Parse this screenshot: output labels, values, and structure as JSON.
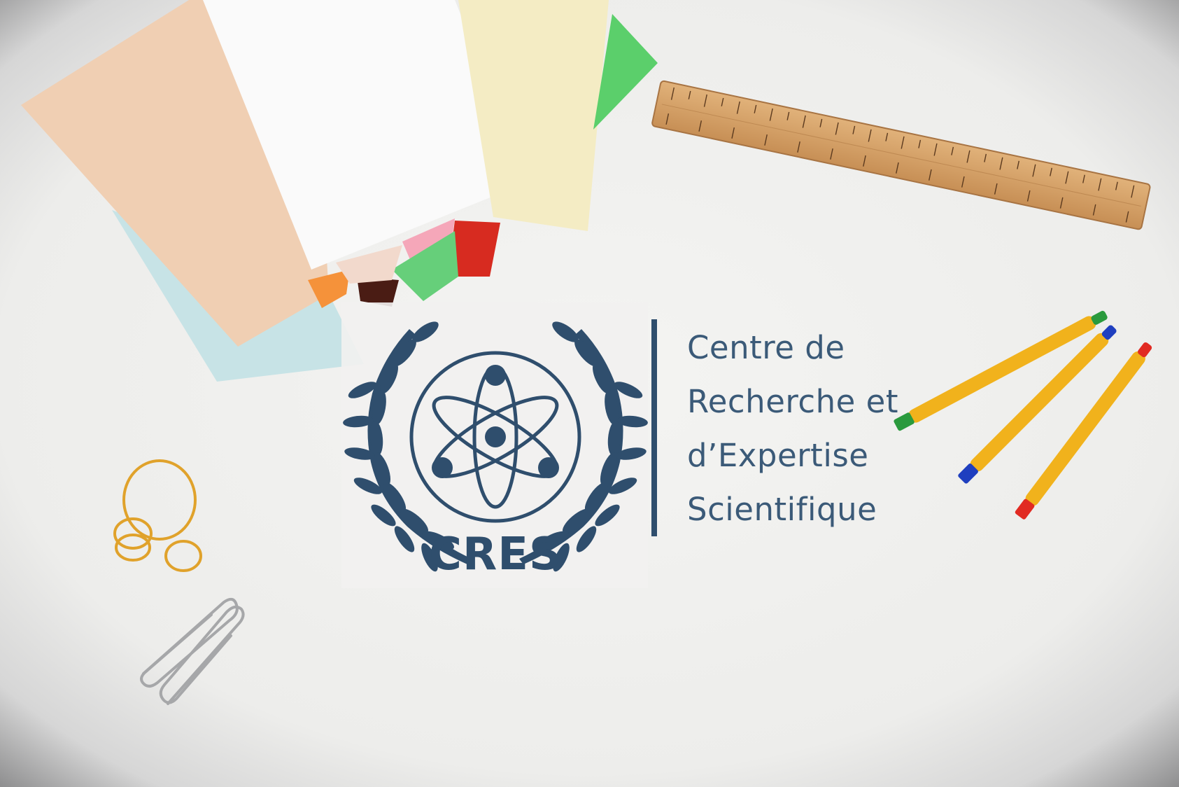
{
  "logo": {
    "acronym": "CRES",
    "name_lines": [
      "Centre de",
      "Recherche et",
      "d’Expertise",
      "Scientifique"
    ],
    "brand_color": "#2f4e6d"
  },
  "scene_objects": [
    "colored-paper-sheets-icon",
    "wooden-ruler-icon",
    "marker-green-icon",
    "marker-blue-icon",
    "marker-red-icon",
    "rubber-bands-icon",
    "paper-clips-icon"
  ]
}
